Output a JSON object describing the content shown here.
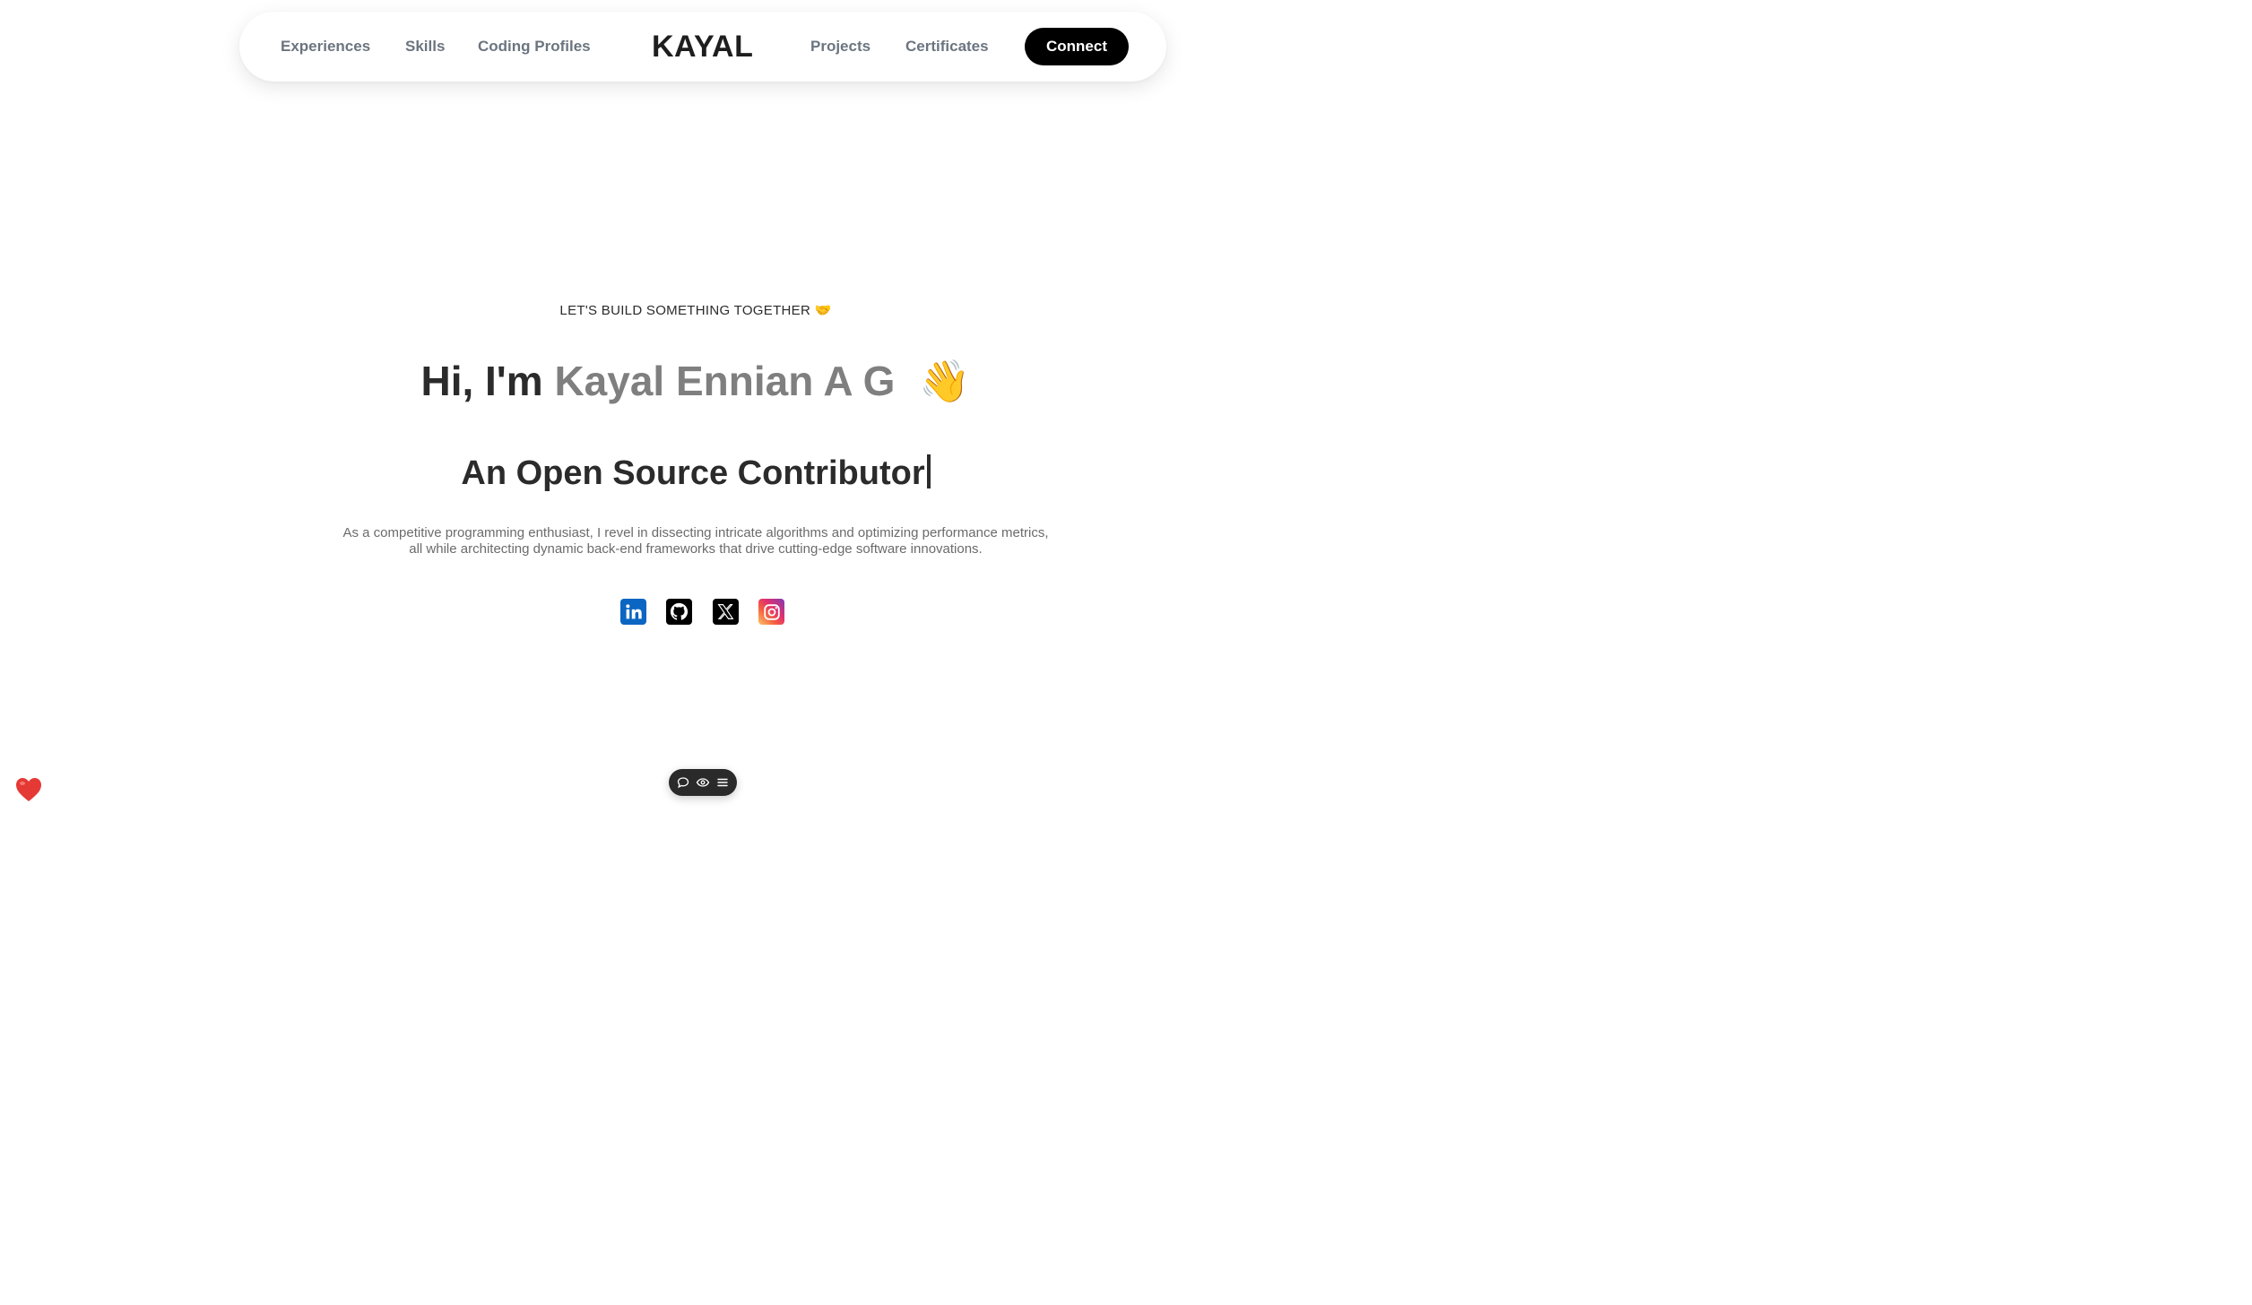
{
  "nav": {
    "links_left": [
      "Experiences",
      "Skills",
      "Coding Profiles"
    ],
    "brand": "KAYAL",
    "links_right": [
      "Projects",
      "Certificates"
    ],
    "connect_label": "Connect"
  },
  "hero": {
    "tagline": "LET'S BUILD SOMETHING TOGETHER",
    "tagline_emoji": "🤝",
    "greeting_prefix": "Hi, I'm",
    "name": "Kayal Ennian A G",
    "wave_emoji": "👋",
    "role": "An Open Source Contributor",
    "bio_line1": "As a competitive programming enthusiast, I revel in dissecting intricate algorithms and optimizing performance metrics,",
    "bio_line2": "all while architecting dynamic back-end frameworks that drive cutting-edge software innovations."
  },
  "social": [
    {
      "icon": "linkedin-icon",
      "color": "#0a66c2"
    },
    {
      "icon": "github-icon",
      "color": "#000000"
    },
    {
      "icon": "x-icon",
      "color": "#000000"
    },
    {
      "icon": "instagram-icon",
      "color": "#e1306c"
    }
  ],
  "toolbar": {
    "icons": [
      "comment-icon",
      "eye-icon",
      "menu-icon"
    ],
    "background": "#2a2a2a"
  },
  "colors": {
    "accent_name": "#7f7f7f",
    "nav_link": "#6b7580",
    "connect_bg": "#000000",
    "heart": "#e53935"
  }
}
